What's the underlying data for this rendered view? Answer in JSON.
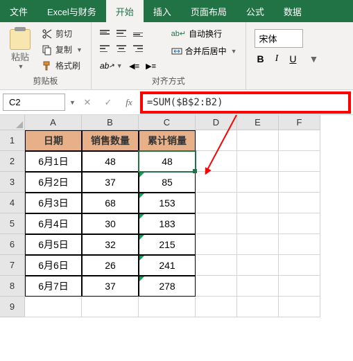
{
  "tabs": {
    "file": "文件",
    "group": "Excel与财务",
    "home": "开始",
    "insert": "插入",
    "layout": "页面布局",
    "formulas": "公式",
    "data": "数据"
  },
  "clipboard": {
    "paste": "粘贴",
    "cut": "剪切",
    "copy": "复制",
    "painter": "格式刷",
    "label": "剪贴板"
  },
  "alignment": {
    "wrap": "自动换行",
    "merge": "合并后居中",
    "label": "对齐方式"
  },
  "font": {
    "family": "宋体",
    "bold": "B",
    "italic": "I",
    "underline": "U"
  },
  "formula_bar": {
    "name_box": "C2",
    "formula": "=SUM($B$2:B2)"
  },
  "columns": [
    "A",
    "B",
    "C",
    "D",
    "E",
    "F"
  ],
  "rows": [
    "1",
    "2",
    "3",
    "4",
    "5",
    "6",
    "7",
    "8",
    "9"
  ],
  "headers": {
    "date": "日期",
    "qty": "销售数量",
    "cum": "累计销量"
  },
  "chart_data": {
    "type": "table",
    "columns": [
      "日期",
      "销售数量",
      "累计销量"
    ],
    "rows": [
      [
        "6月1日",
        48,
        48
      ],
      [
        "6月2日",
        37,
        85
      ],
      [
        "6月3日",
        68,
        153
      ],
      [
        "6月4日",
        30,
        183
      ],
      [
        "6月5日",
        32,
        215
      ],
      [
        "6月6日",
        26,
        241
      ],
      [
        "6月7日",
        37,
        278
      ]
    ]
  }
}
